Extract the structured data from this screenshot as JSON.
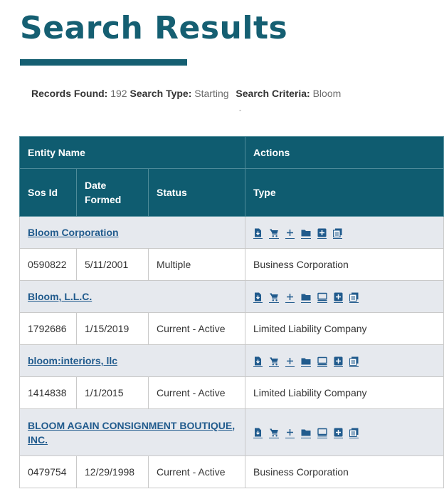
{
  "page": {
    "title": "Search Results"
  },
  "summary": {
    "records_label": "Records Found:",
    "records_value": "192",
    "type_label": "Search Type:",
    "type_value": "Starting",
    "criteria_label": "Search Criteria:",
    "criteria_value": "Bloom",
    "dash": "-"
  },
  "table": {
    "headers": {
      "entity_name": "Entity Name",
      "actions": "Actions",
      "sos_id": "Sos Id",
      "date_formed": "Date Formed",
      "status": "Status",
      "type": "Type"
    },
    "rows": [
      {
        "name": "Bloom Corporation",
        "sos_id": "0590822",
        "date_formed": "5/11/2001",
        "status": "Multiple",
        "type": "Business Corporation"
      },
      {
        "name": "Bloom, L.L.C.",
        "sos_id": "1792686",
        "date_formed": "1/15/2019",
        "status": "Current - Active",
        "type": "Limited Liability Company"
      },
      {
        "name": "bloom:interiors, llc",
        "sos_id": "1414838",
        "date_formed": "1/1/2015",
        "status": "Current - Active",
        "type": "Limited Liability Company"
      },
      {
        "name": "BLOOM AGAIN CONSIGNMENT BOUTIQUE, INC.",
        "sos_id": "0479754",
        "date_formed": "12/29/1998",
        "status": "Current - Active",
        "type": "Business Corporation"
      }
    ]
  },
  "action_icons": [
    "document-download-icon",
    "cart-icon",
    "plus-icon",
    "folder-icon",
    "monitor-icon",
    "add-box-icon",
    "copies-icon"
  ],
  "colors": {
    "brand": "#155f72",
    "header_bg": "#0f5c70",
    "link": "#215b8d",
    "row_alt": "#e6e9ee"
  }
}
